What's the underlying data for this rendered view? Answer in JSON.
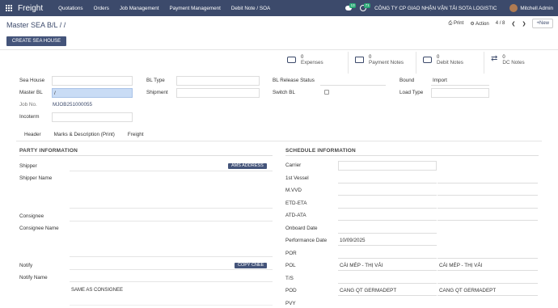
{
  "topnav": {
    "brand": "Freight",
    "menu": [
      "Quotations",
      "Orders",
      "Job Management",
      "Payment Management",
      "Debit Note / SOA"
    ],
    "chat_badge": "13",
    "activity_badge": "71",
    "company": "CÔNG TY CP GIAO NHẬN VẬN TẢI SOTA LOGISTIC",
    "user": "Mitchell Admin"
  },
  "control": {
    "breadcrumb": "Master SEA B/L / /",
    "print": "Print",
    "action": "Action",
    "pager": "4 / 8",
    "new": "New",
    "create_button": "CREATE SEA HOUSE"
  },
  "smart_buttons": [
    {
      "count": "0",
      "label": "Expenses"
    },
    {
      "count": "0",
      "label": "Payment Notes"
    },
    {
      "count": "0",
      "label": "Debit Notes"
    },
    {
      "count": "0",
      "label": "DC Notes"
    }
  ],
  "form": {
    "sea_house_label": "Sea House",
    "master_bl_label": "Master BL",
    "master_bl_value": "/",
    "job_no_label": "Job No.",
    "job_no_value": "MJOB251000055",
    "incoterm_label": "Incoterm",
    "bl_type_label": "BL Type",
    "shipment_label": "Shipment",
    "bl_release_label": "BL Release Status",
    "switch_bl_label": "Switch BL",
    "bound_label": "Bound",
    "bound_value": "Import",
    "load_type_label": "Load Type"
  },
  "tabs": [
    "Header",
    "Marks & Description (Print)",
    "Freight"
  ],
  "party": {
    "title": "PARTY INFORMATION",
    "shipper": "Shipper",
    "ams_button": "AMS ADDRESS",
    "shipper_name": "Shipper Name",
    "consignee": "Consignee",
    "consignee_name": "Consignee Name",
    "notify": "Notify",
    "copy_button": "COPY CNEE",
    "notify_name": "Notify Name",
    "notify_name_value": "SAME AS CONSIGNEE"
  },
  "schedule": {
    "title": "SCHEDULE INFORMATION",
    "rows": [
      {
        "label": "Carrier",
        "v1": "",
        "v2": ""
      },
      {
        "label": "1st Vessel",
        "v1": "",
        "v2": ""
      },
      {
        "label": "M.VVD",
        "v1": "",
        "v2": ""
      },
      {
        "label": "ETD-ETA",
        "v1": "",
        "v2": ""
      },
      {
        "label": "ATD-ATA",
        "v1": "",
        "v2": ""
      },
      {
        "label": "Onboard Date",
        "v1": "",
        "v2": ""
      },
      {
        "label": "Performance Date",
        "v1": "10/09/2025",
        "v2": ""
      },
      {
        "label": "POR",
        "v1": "",
        "v2": ""
      },
      {
        "label": "POL",
        "v1": "CÁI MÉP - THỊ VẢI",
        "v2": "CÁI MÉP - THỊ VẢI"
      },
      {
        "label": "T/S",
        "v1": "",
        "v2": ""
      },
      {
        "label": "POD",
        "v1": "CANG QT GERMADEPT",
        "v2": "CANG QT GERMADEPT"
      },
      {
        "label": "PVY",
        "v1": "",
        "v2": ""
      }
    ]
  }
}
